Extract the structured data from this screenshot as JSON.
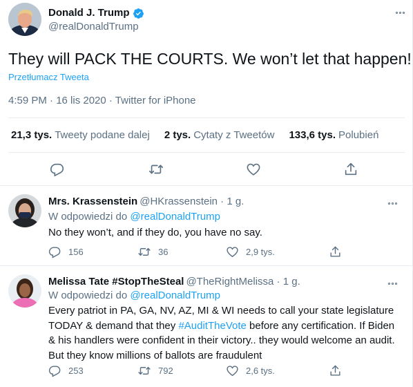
{
  "tweet": {
    "display_name": "Donald J. Trump",
    "handle": "@realDonaldTrump",
    "text": "They will PACK THE COURTS. We won’t let that happen!",
    "translate_label": "Przetłumacz Tweeta",
    "meta": "4:59 PM · 16 lis 2020 · Twitter for iPhone",
    "stats": [
      {
        "count": "21,3 tys.",
        "label": "Tweety podane dalej"
      },
      {
        "count": "2 tys.",
        "label": "Cytaty z Tweetów"
      },
      {
        "count": "133,6 tys.",
        "label": "Polubień"
      }
    ],
    "actions": [
      "reply-icon",
      "retweet-icon",
      "like-icon",
      "share-icon"
    ]
  },
  "replies": [
    {
      "display_name": "Mrs. Krassenstein",
      "handle": "@HKrassenstein · 1 g.",
      "reply_prefix": "W odpowiedzi do",
      "reply_mention": "@realDonaldTrump",
      "text": "No they won’t, and if they do, you have no say.",
      "reply_count": "156",
      "retweet_count": "36",
      "like_count": "2,9 tys."
    },
    {
      "display_name": "Melissa Tate #StopTheSteal",
      "handle": "@TheRightMelissa · 1 g.",
      "reply_prefix": "W odpowiedzi do",
      "reply_mention": "@realDonaldTrump",
      "text_parts": [
        "Every patriot in PA, GA, NV, AZ, MI & WI needs to call your state legislature TODAY & demand that they ",
        "#AuditTheVote",
        " before any certification. If Biden & his handlers were confident in their victory.. they would welcome an audit. But they know millions of ballots are fraudulent"
      ],
      "reply_count": "253",
      "retweet_count": "792",
      "like_count": "2,6 tys."
    }
  ],
  "colors": {
    "accent": "#1da1f2",
    "secondary_text": "#5b7083",
    "divider": "#e6ecf0"
  }
}
